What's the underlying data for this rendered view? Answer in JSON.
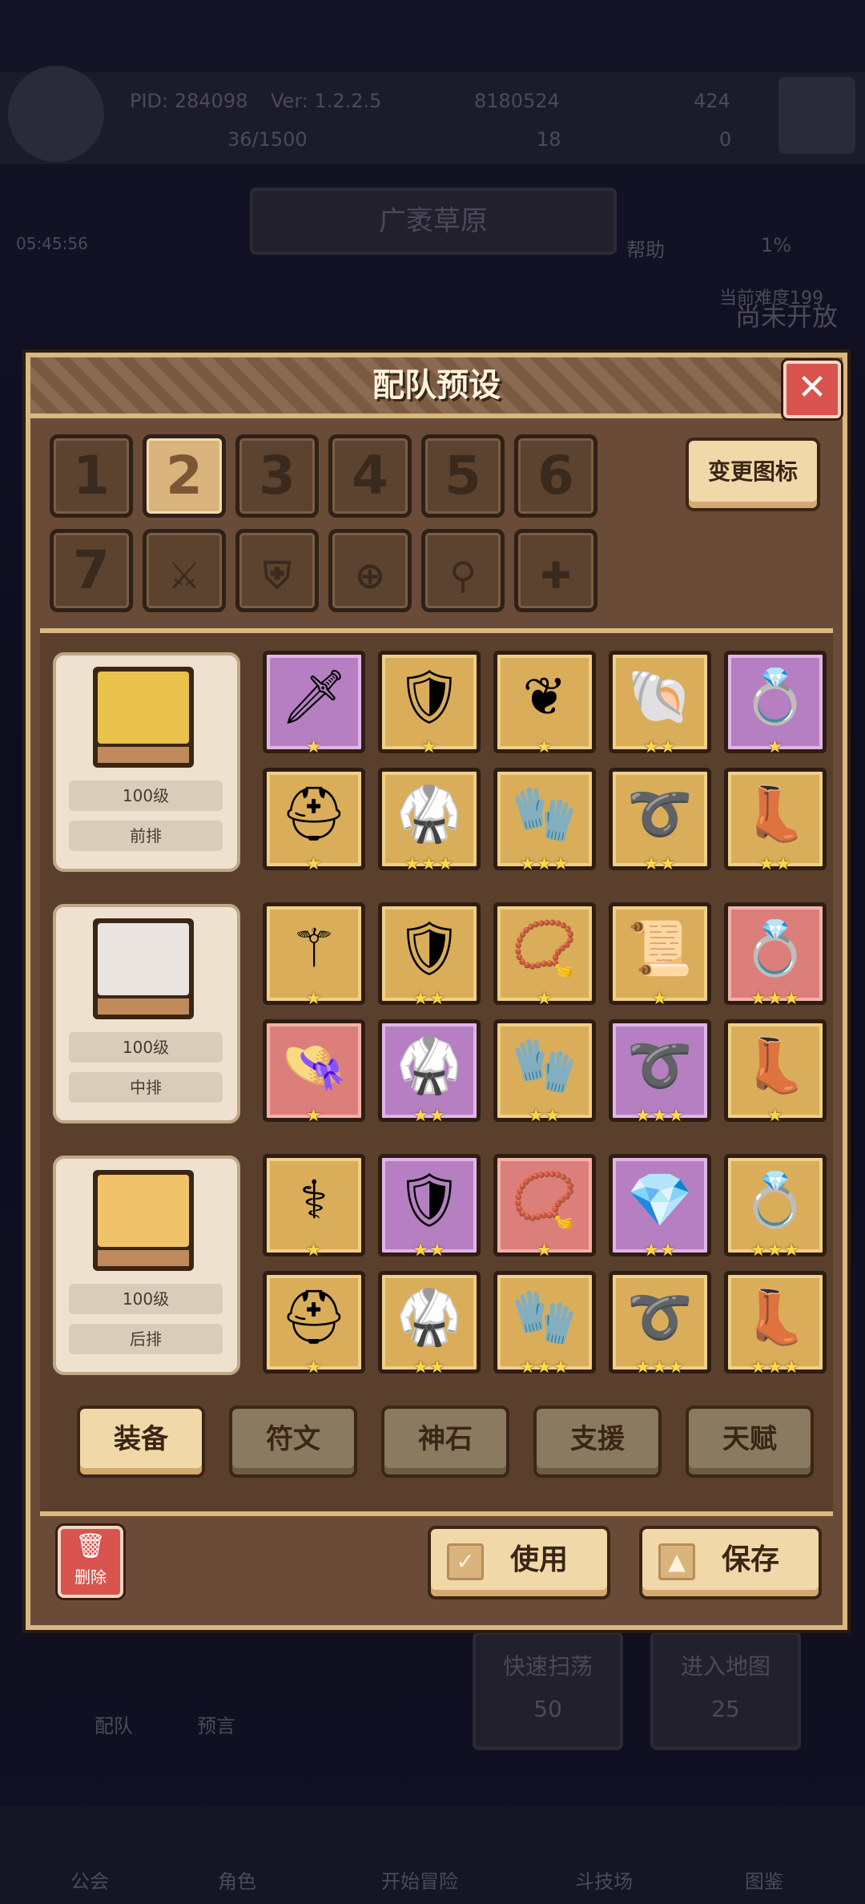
{
  "header": {
    "pid": "PID: 284098",
    "version": "Ver: 1.2.2.5",
    "gold": "8180524",
    "gems": "424",
    "stamina": "36/1500",
    "clover": "18",
    "keys": "0",
    "timer": "05:45:56",
    "map_name": "广袤草原",
    "help_label": "帮助",
    "progress": "1%",
    "difficulty": "当前难度199",
    "coming": "尚未开放"
  },
  "background": {
    "quick_sweep": "快速扫荡",
    "quick_sweep_cost": "50",
    "enter_map": "进入地图",
    "enter_map_cost": "25",
    "team_label": "配队",
    "preview_label": "预言",
    "nav": [
      "公会",
      "角色",
      "开始冒险",
      "斗技场",
      "图鉴"
    ]
  },
  "modal": {
    "title": "配队预设",
    "close_icon": "close-icon",
    "preset_numbers": [
      "1",
      "2",
      "3",
      "4",
      "5",
      "6",
      "7"
    ],
    "selected_preset": "2",
    "preset_icons": [
      "sword-icon",
      "shield-icon",
      "crosshair-icon",
      "staff-icon",
      "cross-icon"
    ],
    "change_icon_label": "变更图标",
    "heroes": [
      {
        "level": "100级",
        "position": "前排",
        "portrait_color": "#e8c24a"
      },
      {
        "level": "100级",
        "position": "中排",
        "portrait_color": "#e9e4df"
      },
      {
        "level": "100级",
        "position": "后排",
        "portrait_color": "#f0c36a"
      }
    ],
    "equipment": [
      [
        {
          "icon": "sword-icon",
          "bg": "purple",
          "stars": "★"
        },
        {
          "icon": "shield-icon",
          "bg": "gold",
          "stars": "★"
        },
        {
          "icon": "amulet-icon",
          "bg": "gold",
          "stars": "★"
        },
        {
          "icon": "shell-icon",
          "bg": "gold",
          "stars": "★★"
        },
        {
          "icon": "ring-icon",
          "bg": "purple",
          "stars": "★"
        },
        {
          "icon": "helmet-icon",
          "bg": "gold",
          "stars": "★"
        },
        {
          "icon": "armor-icon",
          "bg": "gold",
          "stars": "★★★"
        },
        {
          "icon": "gloves-icon",
          "bg": "gold",
          "stars": "★★★"
        },
        {
          "icon": "belt-icon",
          "bg": "gold",
          "stars": "★★"
        },
        {
          "icon": "boots-icon",
          "bg": "gold",
          "stars": "★★"
        }
      ],
      [
        {
          "icon": "staff-icon",
          "bg": "gold",
          "stars": "★"
        },
        {
          "icon": "shield-icon",
          "bg": "gold",
          "stars": "★★"
        },
        {
          "icon": "necklace-icon",
          "bg": "gold",
          "stars": "★"
        },
        {
          "icon": "scroll-icon",
          "bg": "gold",
          "stars": "★"
        },
        {
          "icon": "ring-icon",
          "bg": "red",
          "stars": "★★★"
        },
        {
          "icon": "hat-icon",
          "bg": "red",
          "stars": "★"
        },
        {
          "icon": "armor-icon",
          "bg": "purple",
          "stars": "★★"
        },
        {
          "icon": "gloves-icon",
          "bg": "gold",
          "stars": "★★"
        },
        {
          "icon": "belt-icon",
          "bg": "purple",
          "stars": "★★★"
        },
        {
          "icon": "boots-icon",
          "bg": "gold",
          "stars": "★"
        }
      ],
      [
        {
          "icon": "wand-icon",
          "bg": "gold",
          "stars": "★"
        },
        {
          "icon": "shield-icon",
          "bg": "purple",
          "stars": "★★"
        },
        {
          "icon": "necklace-icon",
          "bg": "red",
          "stars": "★"
        },
        {
          "icon": "gem-icon",
          "bg": "purple",
          "stars": "★★"
        },
        {
          "icon": "ring-icon",
          "bg": "gold",
          "stars": "★★★"
        },
        {
          "icon": "helmet-icon",
          "bg": "gold",
          "stars": "★"
        },
        {
          "icon": "armor-icon",
          "bg": "gold",
          "stars": "★★"
        },
        {
          "icon": "gloves-icon",
          "bg": "gold",
          "stars": "★★★"
        },
        {
          "icon": "belt-icon",
          "bg": "gold",
          "stars": "★★★"
        },
        {
          "icon": "boots-icon",
          "bg": "gold",
          "stars": "★★★"
        }
      ]
    ],
    "tabs": [
      "装备",
      "符文",
      "神石",
      "支援",
      "天赋"
    ],
    "active_tab": "装备",
    "delete_label": "删除",
    "use_label": "使用",
    "save_label": "保存"
  }
}
